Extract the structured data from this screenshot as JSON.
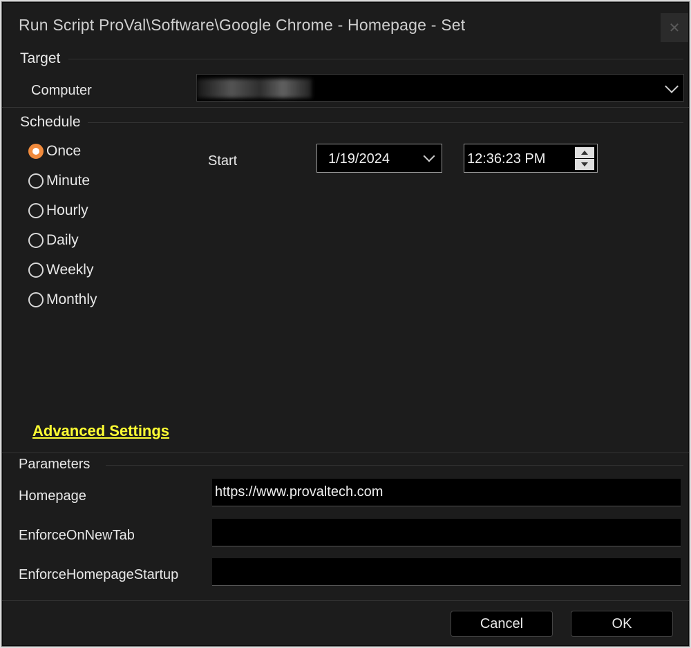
{
  "window": {
    "title": "Run Script ProVal\\Software\\Google Chrome - Homepage - Set",
    "close_glyph": "✕"
  },
  "target": {
    "section_label": "Target",
    "computer_label": "Computer",
    "computer_value": ""
  },
  "schedule": {
    "section_label": "Schedule",
    "options": [
      "Once",
      "Minute",
      "Hourly",
      "Daily",
      "Weekly",
      "Monthly"
    ],
    "selected": "Once",
    "start_label": "Start",
    "date": "1/19/2024",
    "time": "12:36:23 PM"
  },
  "advanced_settings_label": "Advanced Settings",
  "parameters": {
    "section_label": "Parameters",
    "fields": [
      {
        "label": "Homepage",
        "value": "https://www.provaltech.com"
      },
      {
        "label": "EnforceOnNewTab",
        "value": ""
      },
      {
        "label": "EnforceHomepageStartup",
        "value": ""
      }
    ]
  },
  "buttons": {
    "cancel": "Cancel",
    "ok": "OK"
  },
  "colors": {
    "accent_radio": "#f08a3c",
    "link": "#ffff33",
    "background": "#1c1c1c"
  }
}
